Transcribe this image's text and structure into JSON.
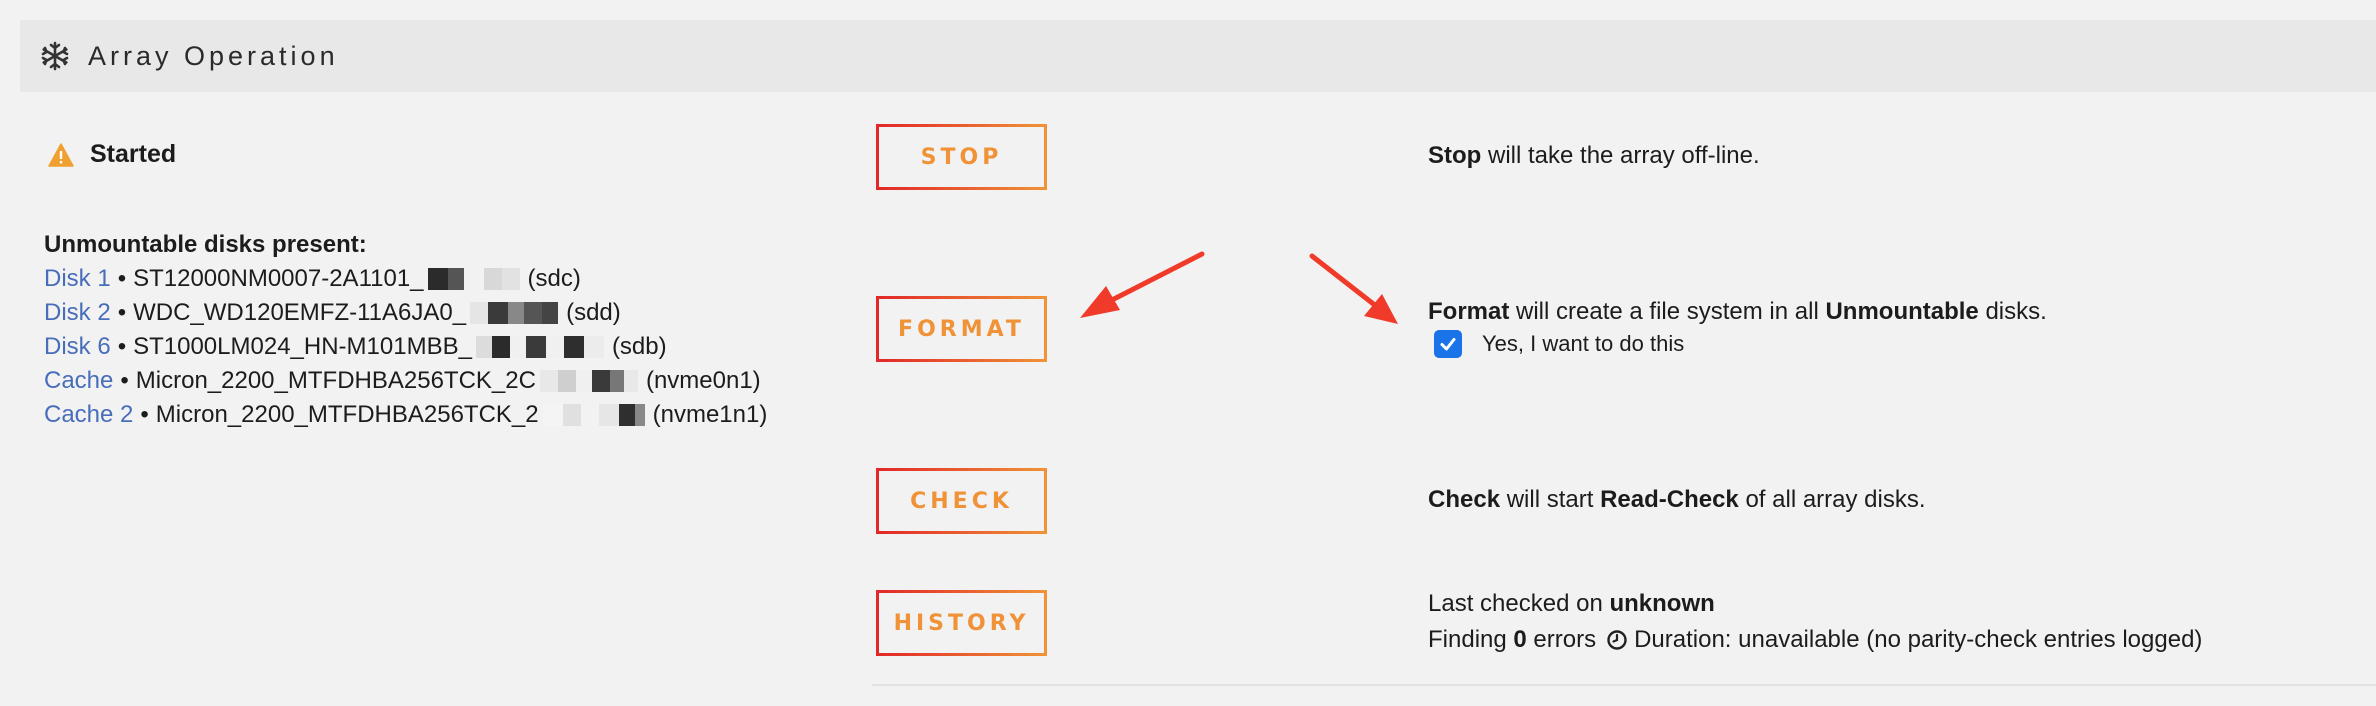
{
  "header": {
    "title": "Array Operation",
    "icon": "snowflake-icon"
  },
  "status": {
    "text": "Started",
    "icon": "warning-icon",
    "icon_color": "#f0a030"
  },
  "disks": {
    "heading": "Unmountable disks present:",
    "rows": [
      {
        "name": "Disk 1",
        "sep": "•",
        "model": "ST12000NM0007-2A1101_",
        "dev": "(sdc)"
      },
      {
        "name": "Disk 2",
        "sep": "•",
        "model": "WDC_WD120EMFZ-11A6JA0_",
        "dev": "(sdd)"
      },
      {
        "name": "Disk 6",
        "sep": "•",
        "model": "ST1000LM024_HN-M101MBB_",
        "dev": "(sdb)"
      },
      {
        "name": "Cache",
        "sep": "•",
        "model": "Micron_2200_MTFDHBA256TCK_2C",
        "dev": "(nvme0n1)"
      },
      {
        "name": "Cache 2",
        "sep": "•",
        "model": "Micron_2200_MTFDHBA256TCK_2",
        "dev": "(nvme1n1)"
      }
    ]
  },
  "buttons": {
    "stop": "STOP",
    "format": "FORMAT",
    "check": "CHECK",
    "history": "HISTORY"
  },
  "descriptions": {
    "stop": {
      "bold": "Stop",
      "rest": " will take the array off-line."
    },
    "format": {
      "bold1": "Format",
      "mid": " will create a file system in all ",
      "bold2": "Unmountable",
      "end": " disks."
    },
    "format_confirm": {
      "label": "Yes, I want to do this",
      "checked": true
    },
    "check": {
      "bold1": "Check",
      "mid": " will start ",
      "bold2": "Read-Check",
      "end": " of all array disks."
    },
    "history": {
      "last_prefix": "Last checked on ",
      "last_value": "unknown",
      "finding_prefix": "Finding ",
      "errors": "0",
      "errors_suffix": " errors",
      "duration": "Duration: unavailable (no parity-check entries logged)"
    }
  },
  "colors": {
    "accent_orange": "#f09237",
    "accent_red": "#e22828",
    "link": "#486dba",
    "checkbox": "#1a73e8",
    "annotation_arrow": "#f03a2a"
  }
}
